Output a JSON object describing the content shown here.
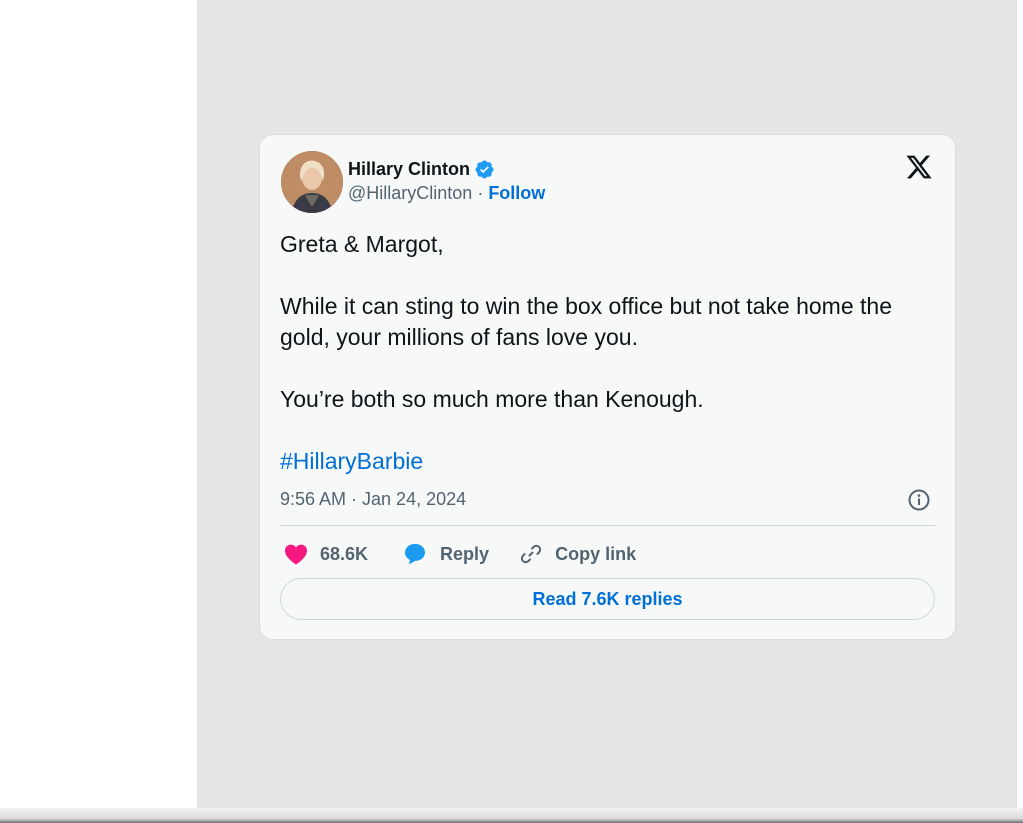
{
  "tweet": {
    "author_name": "Hillary Clinton",
    "handle": "@HillaryClinton",
    "separator": " · ",
    "follow_label": "Follow",
    "body": "Greta & Margot,\n\nWhile it can sting to win the box office but not take home the gold, your millions of fans love you.\n\nYou’re both so much more than Kenough.",
    "hashtag": "#HillaryBarbie",
    "timestamp": "9:56 AM · Jan 24, 2024",
    "likes": "68.6K",
    "reply_label": "Reply",
    "copy_link_label": "Copy link",
    "read_replies_label": "Read 7.6K replies",
    "icons": [
      "verified-badge-icon",
      "x-logo-icon",
      "info-icon",
      "heart-icon",
      "reply-bubble-icon",
      "link-icon"
    ]
  },
  "colors": {
    "link_blue": "#006fd6",
    "verified_blue": "#1d9bf0",
    "heart_pink": "#f91880",
    "muted_text": "#536471",
    "card_bg": "#f7f9f9",
    "stage_bg": "#e5e5e5"
  }
}
